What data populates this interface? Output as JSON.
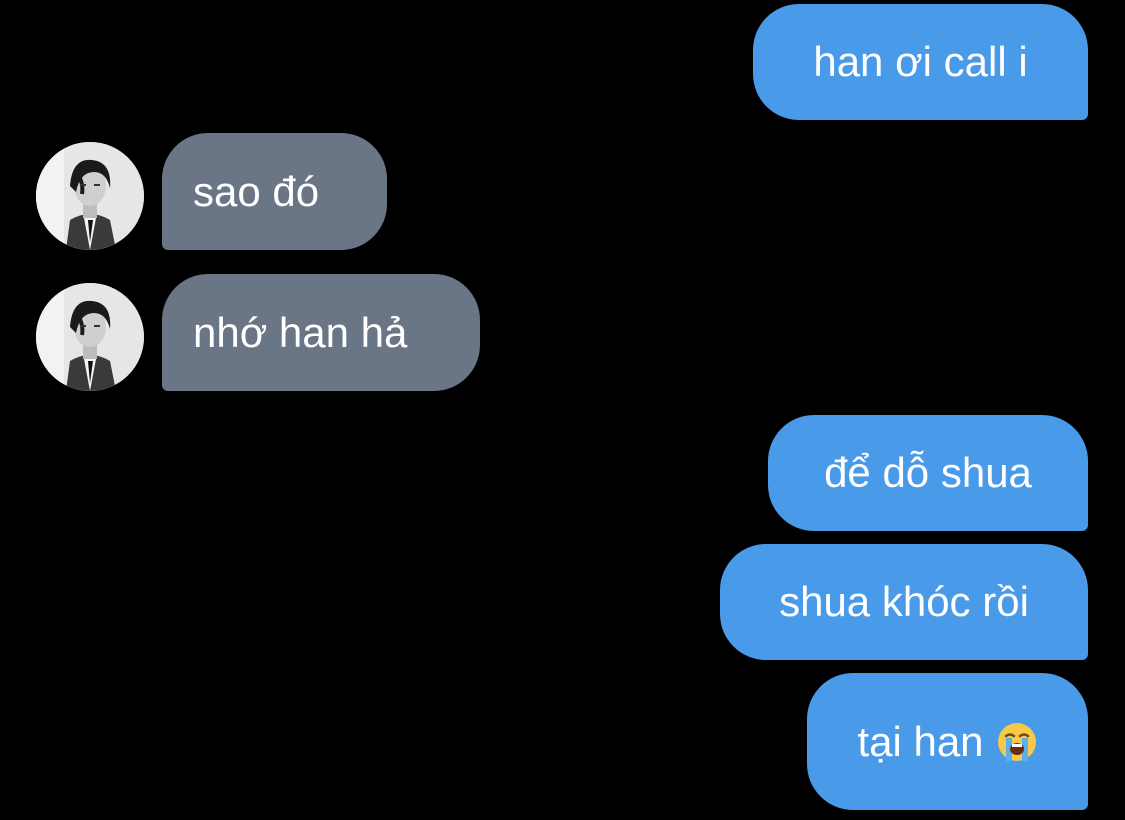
{
  "conversation": {
    "messages": [
      {
        "direction": "outgoing",
        "text": "han ơi call i"
      },
      {
        "direction": "incoming",
        "text": "sao đó",
        "avatar": "avatar-photo"
      },
      {
        "direction": "incoming",
        "text": "nhớ han hả",
        "avatar": "avatar-photo"
      },
      {
        "direction": "outgoing",
        "text": "để dỗ shua"
      },
      {
        "direction": "outgoing",
        "text": "shua khóc rồi"
      },
      {
        "direction": "outgoing",
        "text": "tại han",
        "emoji": "loudly-crying-face-icon"
      }
    ]
  },
  "colors": {
    "background": "#000000",
    "outgoing_bubble": "#4a9aea",
    "incoming_bubble": "#6a7685",
    "text": "#ffffff"
  }
}
